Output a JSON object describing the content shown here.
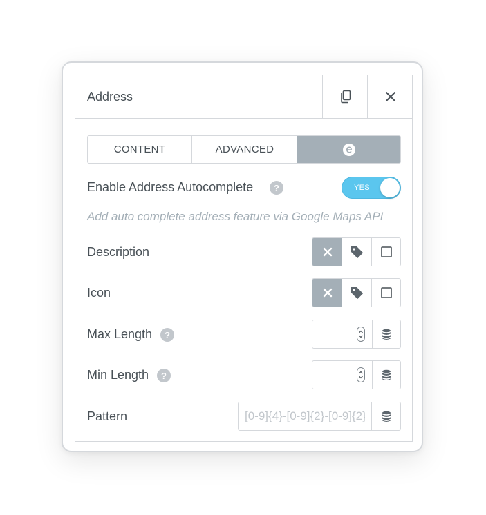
{
  "panel": {
    "title": "Address"
  },
  "tabs": [
    {
      "label": "CONTENT"
    },
    {
      "label": "ADVANCED"
    },
    {
      "label": "",
      "icon": "elementor-e-icon"
    }
  ],
  "autocomplete": {
    "label": "Enable Address Autocomplete",
    "toggle_text": "YES",
    "enabled": true,
    "note": "Add auto complete address feature via Google Maps API"
  },
  "fields": {
    "description": {
      "label": "Description"
    },
    "icon": {
      "label": "Icon"
    },
    "max_length": {
      "label": "Max Length",
      "value": ""
    },
    "min_length": {
      "label": "Min Length",
      "value": ""
    },
    "pattern": {
      "label": "Pattern",
      "placeholder": "[0-9]{4}-[0-9]{2}-[0-9]{2}"
    }
  },
  "help_glyph": "?",
  "colors": {
    "text": "#495157",
    "muted": "#a4afb7",
    "border": "#d5d8dc",
    "toggle_on": "#5bc6ee",
    "active_segment": "#a4afb7"
  }
}
